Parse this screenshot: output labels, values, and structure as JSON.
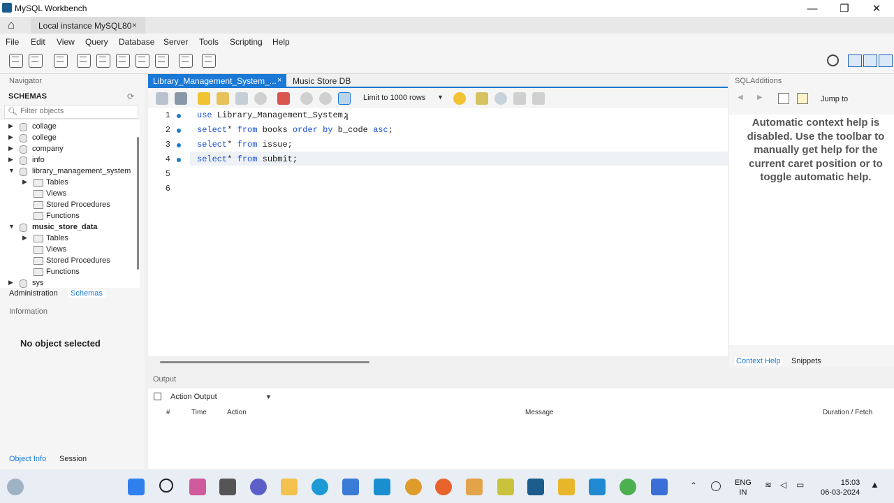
{
  "window": {
    "title": "MySQL Workbench",
    "minimize": "—",
    "restore": "❐",
    "close": "✕"
  },
  "connection_tab": {
    "label": "Local instance MySQL80",
    "close": "×"
  },
  "menu": [
    "File",
    "Edit",
    "View",
    "Query",
    "Database",
    "Server",
    "Tools",
    "Scripting",
    "Help"
  ],
  "navigator": {
    "title": "Navigator",
    "schemas_label": "SCHEMAS",
    "filter_placeholder": "Filter objects",
    "tree": [
      {
        "label": "collage",
        "expanded": false,
        "level": 0,
        "bold": false
      },
      {
        "label": "college",
        "expanded": false,
        "level": 0,
        "bold": false
      },
      {
        "label": "company",
        "expanded": false,
        "level": 0,
        "bold": false
      },
      {
        "label": "info",
        "expanded": false,
        "level": 0,
        "bold": false
      },
      {
        "label": "library_management_system",
        "expanded": true,
        "level": 0,
        "bold": false
      },
      {
        "label": "Tables",
        "level": 1,
        "has_arrow": true
      },
      {
        "label": "Views",
        "level": 1,
        "has_arrow": false
      },
      {
        "label": "Stored Procedures",
        "level": 1,
        "has_arrow": false
      },
      {
        "label": "Functions",
        "level": 1,
        "has_arrow": false
      },
      {
        "label": "music_store_data",
        "expanded": true,
        "level": 0,
        "bold": true
      },
      {
        "label": "Tables",
        "level": 1,
        "has_arrow": true
      },
      {
        "label": "Views",
        "level": 1,
        "has_arrow": false
      },
      {
        "label": "Stored Procedures",
        "level": 1,
        "has_arrow": false
      },
      {
        "label": "Functions",
        "level": 1,
        "has_arrow": false
      },
      {
        "label": "sys",
        "expanded": false,
        "level": 0,
        "bold": false
      }
    ],
    "tabs": [
      "Administration",
      "Schemas"
    ],
    "active_tab": "Schemas"
  },
  "information": {
    "title": "Information",
    "message": "No object selected",
    "tabs": [
      "Object Info",
      "Session"
    ]
  },
  "editor": {
    "tabs": [
      {
        "label": "Library_Management_System_...",
        "active": true,
        "close": "×"
      },
      {
        "label": "Music Store DB",
        "active": false
      }
    ],
    "limit_label": "Limit to 1000 rows",
    "lines": [
      {
        "num": "1",
        "marker": true,
        "tokens": [
          [
            "kw",
            "use"
          ],
          [
            "t",
            " Library_Management_System;"
          ]
        ]
      },
      {
        "num": "2",
        "marker": true,
        "tokens": [
          [
            "kw",
            "select"
          ],
          [
            "t",
            "* "
          ],
          [
            "kw",
            "from"
          ],
          [
            "t",
            " books "
          ],
          [
            "kw",
            "order by"
          ],
          [
            "t",
            " b_code "
          ],
          [
            "kw",
            "asc"
          ],
          [
            "t",
            ";"
          ]
        ]
      },
      {
        "num": "3",
        "marker": true,
        "tokens": [
          [
            "kw",
            "select"
          ],
          [
            "t",
            "* "
          ],
          [
            "kw",
            "from"
          ],
          [
            "t",
            " issue;"
          ]
        ]
      },
      {
        "num": "4",
        "marker": true,
        "tokens": [
          [
            "kw",
            "select"
          ],
          [
            "t",
            "* "
          ],
          [
            "kw",
            "from"
          ],
          [
            "t",
            " submit;"
          ]
        ]
      },
      {
        "num": "5",
        "marker": false,
        "tokens": []
      },
      {
        "num": "6",
        "marker": false,
        "tokens": []
      }
    ]
  },
  "sql_additions": {
    "title": "SQLAdditions",
    "jump_to": "Jump to",
    "help_text": "Automatic context help is disabled. Use the toolbar to manually get help for the current caret position or to toggle automatic help.",
    "tabs": [
      "Context Help",
      "Snippets"
    ],
    "active_tab": "Context Help"
  },
  "output": {
    "title": "Output",
    "selector": "Action Output",
    "columns": [
      "#",
      "Time",
      "Action",
      "Message",
      "Duration / Fetch"
    ]
  },
  "taskbar": {
    "lang_top": "ENG",
    "lang_bottom": "IN",
    "time": "15:03",
    "date": "06-03-2024"
  },
  "colors": {
    "accent": "#1a78d6",
    "keyword": "#1a4fd6",
    "marker": "#1a7ccc"
  }
}
